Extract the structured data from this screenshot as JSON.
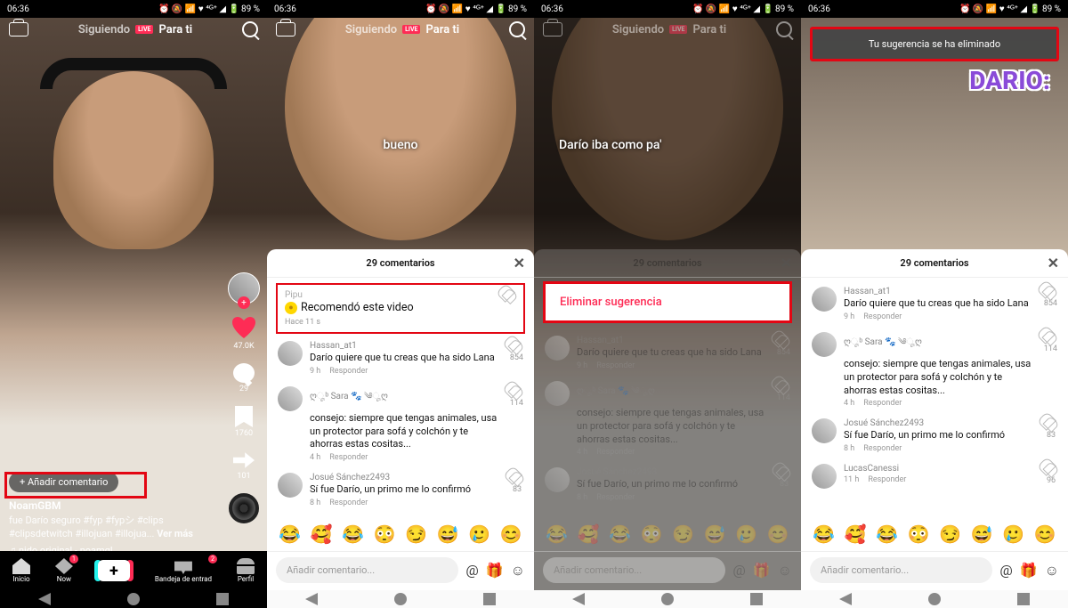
{
  "status": {
    "time": "06:36",
    "battery": "89 %",
    "icons": "⏰ 🔕 📶 ♥ ⁴ᴳ⁺ ◢ 🔋"
  },
  "topnav": {
    "tab1": "Siguiendo",
    "live": "LIVE",
    "tab2": "Para ti"
  },
  "s1": {
    "addComment": "+ Añadir comentario",
    "user": "NoamGBM",
    "desc": "fue Darío seguro #fyp #fypシ #clips #clipsdetwitch #illojuan #illojua... ",
    "more": "Ver más",
    "sound": "♫ nido original - noamgl",
    "rail": {
      "likes": "47.0K",
      "comments": "29",
      "saves": "1760",
      "shares": "101"
    },
    "nav": {
      "home": "Inicio",
      "now": "Now",
      "inbox": "Bandeja de entrad",
      "profile": "Perfil",
      "nowBadge": "1",
      "inboxBadge": "2"
    }
  },
  "sheet": {
    "title": "29 comentarios",
    "placeholder": "Añadir comentario...",
    "emojis": [
      "😂",
      "🥰",
      "😂",
      "😳",
      "😏",
      "😅",
      "🥲",
      "😊"
    ]
  },
  "suggest": {
    "user": "Pipu",
    "text": "Recomendó este video",
    "time": "Hace 11 s"
  },
  "eliminate": "Eliminar sugerencia",
  "toast": "Tu sugerencia se ha eliminado",
  "s2caption": "bueno",
  "s3caption": "Darío iba como pa'",
  "s4caption": "DARIO:",
  "comments": [
    {
      "user": "Hassan_at1",
      "text": "Darío quiere que tu creas que ha sido Lana",
      "time": "9 h",
      "reply": "Responder",
      "likes": "854"
    },
    {
      "user": "ღೄᵇ Sara 🐾 ༄ೄღ",
      "text": "consejo: siempre que tengas animales, usa un protector para sofá y colchón y te ahorras estas cositas...",
      "time": "4 h",
      "reply": "Responder",
      "likes": "114"
    },
    {
      "user": "Josué Sánchez2493",
      "text": "Sí fue Darío, un primo me lo confirmó",
      "time": "8 h",
      "reply": "Responder",
      "likes": "83"
    },
    {
      "user": "LucasCanessi",
      "text": " ",
      "time": "11 h",
      "reply": "Responder",
      "likes": "96"
    }
  ]
}
